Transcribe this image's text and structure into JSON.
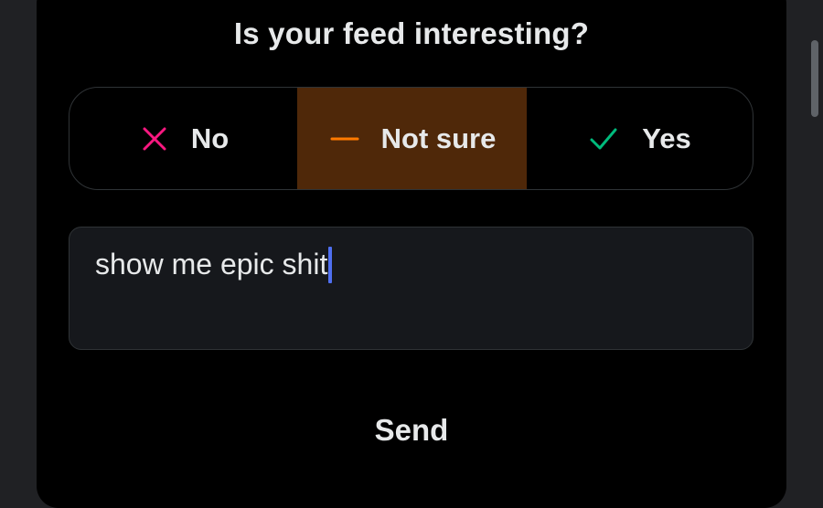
{
  "dialog": {
    "title": "Is your feed interesting?"
  },
  "options": [
    {
      "label": "No",
      "icon": "x-icon",
      "color": "#f91880",
      "selected": false
    },
    {
      "label": "Not sure",
      "icon": "dash-icon",
      "color": "#ff7a00",
      "selected": true
    },
    {
      "label": "Yes",
      "icon": "checkmark-icon",
      "color": "#00ba7c",
      "selected": false
    }
  ],
  "feedback": {
    "value": "show me epic shit"
  },
  "actions": {
    "send_label": "Send"
  },
  "colors": {
    "selected_bg": "#4f2809",
    "caret": "#4f6ff0"
  }
}
